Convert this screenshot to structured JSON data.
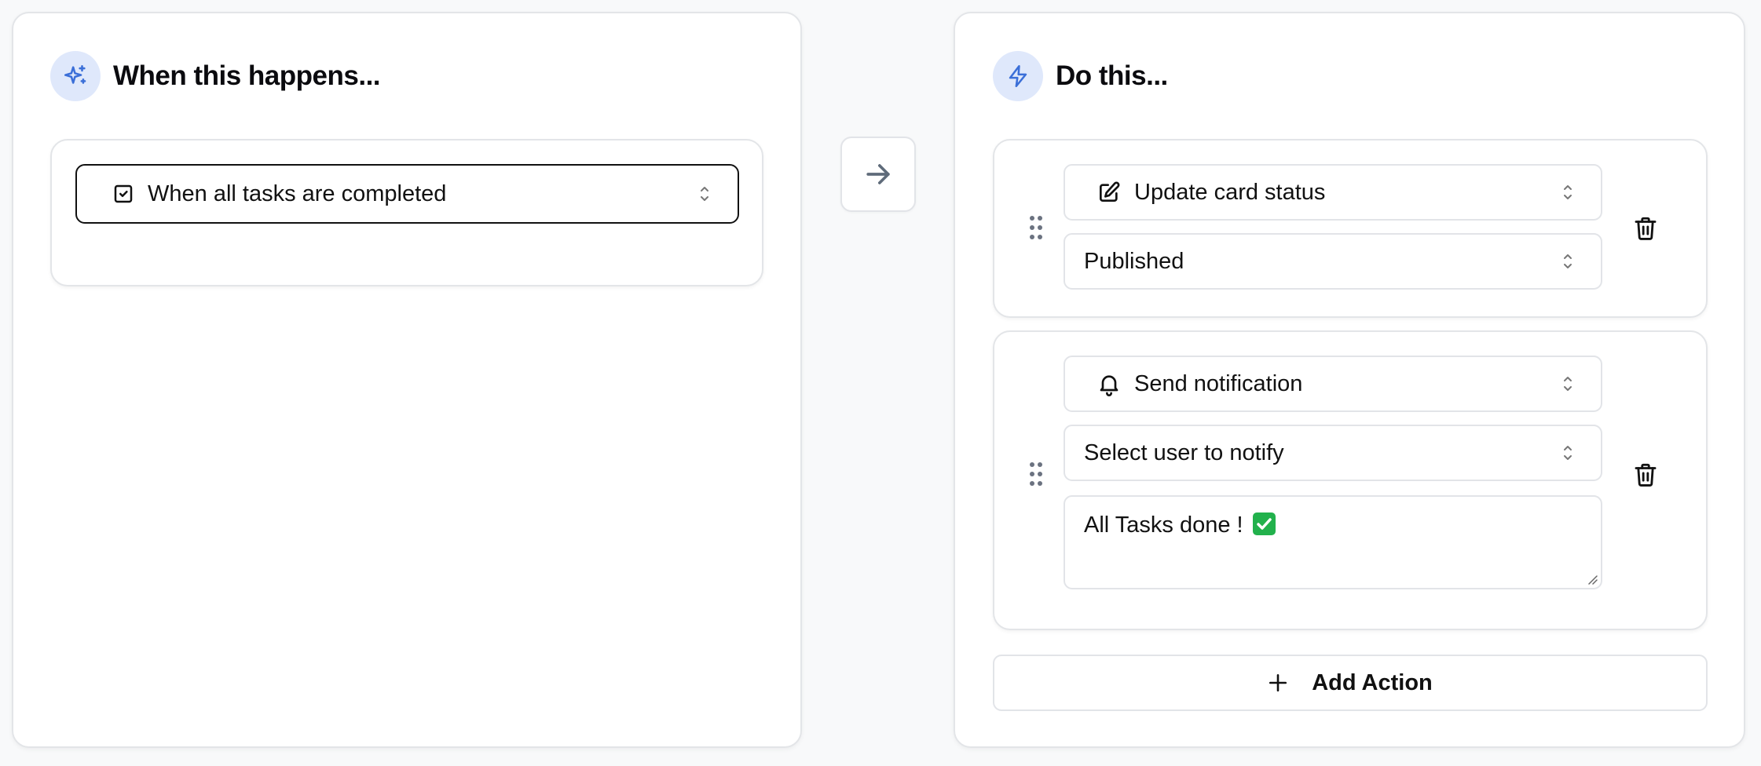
{
  "trigger_panel": {
    "title": "When this happens...",
    "icon": "sparkles-icon",
    "trigger_select": {
      "value": "When all tasks are completed",
      "icon": "square-check-icon"
    }
  },
  "flow_arrow": {
    "icon": "arrow-right-icon"
  },
  "action_panel": {
    "title": "Do this...",
    "icon": "lightning-bolt-icon",
    "actions": [
      {
        "type_select": {
          "value": "Update card status",
          "icon": "pencil-square-icon"
        },
        "status_select": {
          "value": "Published"
        }
      },
      {
        "type_select": {
          "value": "Send notification",
          "icon": "bell-icon"
        },
        "user_select": {
          "value": "Select user to notify"
        },
        "message": {
          "value": "All Tasks done ! ",
          "emoji": "check-mark-button-emoji"
        }
      }
    ],
    "add_action_label": "Add Action"
  },
  "colors": {
    "accent": "#3b6fd8",
    "icon_bg": "#dfe8fb",
    "border": "#e2e4e8",
    "focused_border": "#111111",
    "muted_icon": "#5f6b7a"
  }
}
